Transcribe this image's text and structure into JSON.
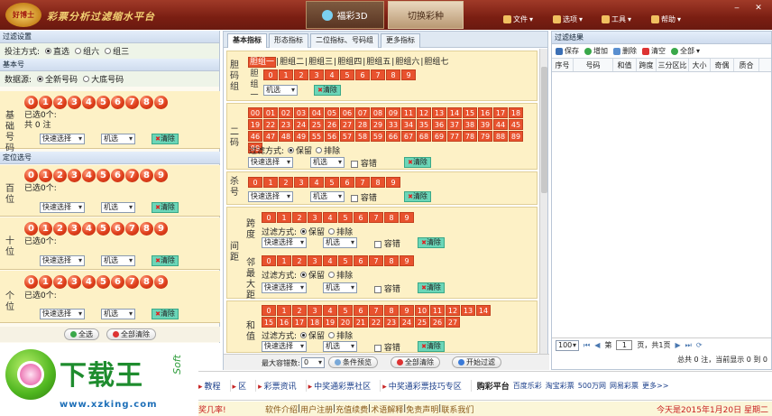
{
  "app": {
    "logo_text": "好博士",
    "title": "彩票分析过滤缩水平台",
    "tab_active": "福彩3D",
    "tab_switch": "切换彩种"
  },
  "menu": {
    "file": "文件",
    "options": "选项",
    "tools": "工具",
    "help": "帮助"
  },
  "left": {
    "filter_settings": "过滤设置",
    "bet_mode_label": "投注方式:",
    "bet_modes": [
      "直选",
      "组六",
      "组三"
    ],
    "basic_section": "基本号",
    "datasource_label": "数据源:",
    "datasources": [
      "全新号码",
      "大底号码"
    ],
    "base_label": "基础号码",
    "base_info1": "已选0个:",
    "base_info2": "共 0 注",
    "quick": "快速选择",
    "random": "机选",
    "clear": "清除",
    "position_section": "定位选号",
    "positions": [
      {
        "label": "百位",
        "info": "已选0个:"
      },
      {
        "label": "十位",
        "info": "已选0个:"
      },
      {
        "label": "个位",
        "info": "已选0个:"
      }
    ],
    "select_all": "全选",
    "clear_all": "全部清除"
  },
  "digits": [
    "0",
    "1",
    "2",
    "3",
    "4",
    "5",
    "6",
    "7",
    "8",
    "9"
  ],
  "center": {
    "tabs": [
      "基本指标",
      "形态指标",
      "二位指标、号码组",
      "更多指标"
    ],
    "group_section": "胆码组",
    "group_tabs": [
      "胆组一",
      "胆组二",
      "胆组三",
      "胆组四",
      "胆组五",
      "胆组六",
      "胆组七"
    ],
    "group1_label": "胆组一",
    "random": "机选",
    "clear": "清除",
    "er_label": "二码",
    "er_nums": [
      "00",
      "01",
      "02",
      "03",
      "04",
      "05",
      "06",
      "07",
      "08",
      "09",
      "11",
      "12",
      "13",
      "14",
      "15",
      "16",
      "17",
      "18",
      "19",
      "22",
      "23",
      "24",
      "25",
      "26",
      "27",
      "28",
      "29",
      "33",
      "34",
      "35",
      "36",
      "37",
      "38",
      "39",
      "44",
      "45",
      "46",
      "47",
      "48",
      "49",
      "55",
      "56",
      "57",
      "58",
      "59",
      "66",
      "67",
      "68",
      "69",
      "77",
      "78",
      "79",
      "88",
      "89",
      "99"
    ],
    "filter_mode": "过滤方式:",
    "keep": "保留",
    "exclude": "排除",
    "quick": "快速选择",
    "tolerance": "容错",
    "kill_label": "杀号",
    "span_group": "间距",
    "span_label": "跨度",
    "adj_label": "邻最大距",
    "sum_label": "和值",
    "sum_nums": [
      "0",
      "1",
      "2",
      "3",
      "4",
      "5",
      "6",
      "7",
      "8",
      "9",
      "10",
      "11",
      "12",
      "13",
      "14",
      "15",
      "16",
      "17",
      "18",
      "19",
      "20",
      "21",
      "22",
      "23",
      "24",
      "25",
      "26",
      "27"
    ],
    "max_tol_label": "最大容错数:",
    "max_tol_value": "0",
    "cond_preview": "条件预览",
    "clear_all": "全部清除",
    "start_filter": "开始过滤"
  },
  "right": {
    "title": "过滤结果",
    "save": "保存",
    "add": "增加",
    "delete": "删除",
    "clear": "清空",
    "all": "全部",
    "columns": [
      "序号",
      "号码",
      "和值",
      "跨度",
      "三分区比",
      "大小",
      "奇偶",
      "质合"
    ],
    "page_size": "100",
    "page_label": "第",
    "page_value": "1",
    "page_total": "页，共1页",
    "summary": "总共 0 注，当前显示 0 到 0"
  },
  "bottom": {
    "links": [
      "教程",
      "区",
      "彩票资讯",
      "中奖通彩票社区",
      "中奖通彩票技巧专区"
    ],
    "buy_platform": "购彩平台",
    "buy_links": [
      "百度乐彩",
      "淘宝彩票",
      "500万网",
      "网易彩票",
      "更多>>"
    ],
    "left_notice": "奖几率!",
    "footer_links": [
      "软件介绍",
      "用户注册",
      "充值续费",
      "术语解释",
      "免责声明",
      "联系我们"
    ],
    "date_text": "今天是2015年1月20日 星期二"
  },
  "watermark": {
    "brand": "下载王",
    "soft": "Soft",
    "url": "www.xzking.com"
  }
}
